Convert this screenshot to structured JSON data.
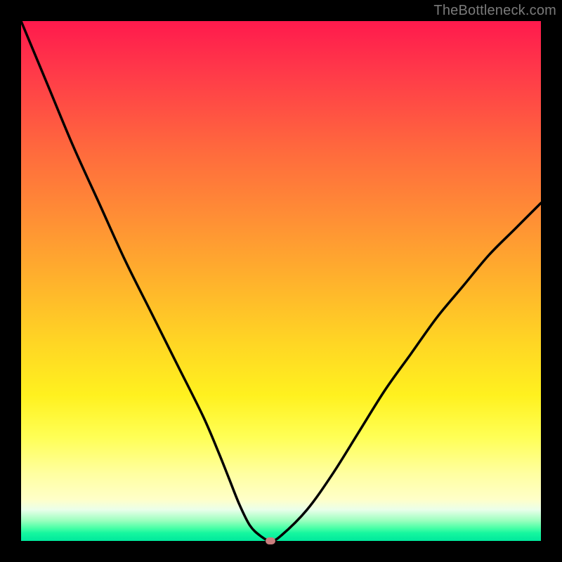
{
  "watermark": "TheBottleneck.com",
  "chart_data": {
    "type": "line",
    "title": "",
    "xlabel": "",
    "ylabel": "",
    "xlim": [
      0,
      100
    ],
    "ylim": [
      0,
      100
    ],
    "grid": false,
    "legend": false,
    "series": [
      {
        "name": "bottleneck-curve",
        "x": [
          0,
          5,
          10,
          15,
          20,
          25,
          30,
          35,
          38,
          40,
          42,
          44,
          46,
          48,
          50,
          55,
          60,
          65,
          70,
          75,
          80,
          85,
          90,
          95,
          100
        ],
        "values": [
          100,
          88,
          76,
          65,
          54,
          44,
          34,
          24,
          17,
          12,
          7,
          3,
          1,
          0,
          1,
          6,
          13,
          21,
          29,
          36,
          43,
          49,
          55,
          60,
          65
        ]
      }
    ],
    "annotations": [
      {
        "name": "min-marker",
        "x": 48,
        "y": 0,
        "color": "#c97e7e"
      }
    ],
    "background_gradient": {
      "top": "#ff1a4d",
      "mid": "#fff11f",
      "bottom": "#00e89c"
    }
  }
}
